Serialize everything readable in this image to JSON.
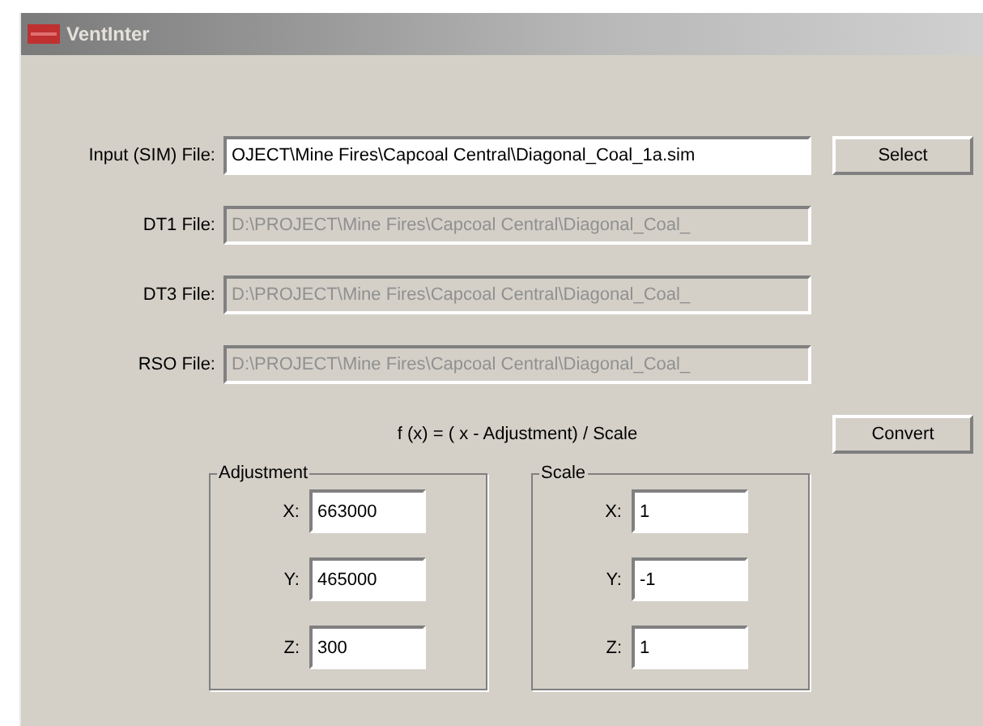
{
  "window": {
    "title": "VentInter"
  },
  "files": [
    {
      "label": "Input (SIM) File:",
      "value": "OJECT\\Mine Fires\\Capcoal Central\\Diagonal_Coal_1a.sim",
      "disabled": false
    },
    {
      "label": "DT1 File:",
      "value": "D:\\PROJECT\\Mine Fires\\Capcoal Central\\Diagonal_Coal_",
      "disabled": true
    },
    {
      "label": "DT3 File:",
      "value": "D:\\PROJECT\\Mine Fires\\Capcoal Central\\Diagonal_Coal_",
      "disabled": true
    },
    {
      "label": "RSO File:",
      "value": "D:\\PROJECT\\Mine Fires\\Capcoal Central\\Diagonal_Coal_",
      "disabled": true
    }
  ],
  "select_button": "Select",
  "formula": "f (x) = ( x - Adjustment) / Scale",
  "convert_button": "Convert",
  "groups": [
    {
      "title": "Adjustment",
      "fields": [
        {
          "label": "X:",
          "value": "663000"
        },
        {
          "label": "Y:",
          "value": "465000"
        },
        {
          "label": "Z:",
          "value": "300"
        }
      ]
    },
    {
      "title": "Scale",
      "fields": [
        {
          "label": "X:",
          "value": "1"
        },
        {
          "label": "Y:",
          "value": "-1"
        },
        {
          "label": "Z:",
          "value": "1"
        }
      ]
    }
  ]
}
